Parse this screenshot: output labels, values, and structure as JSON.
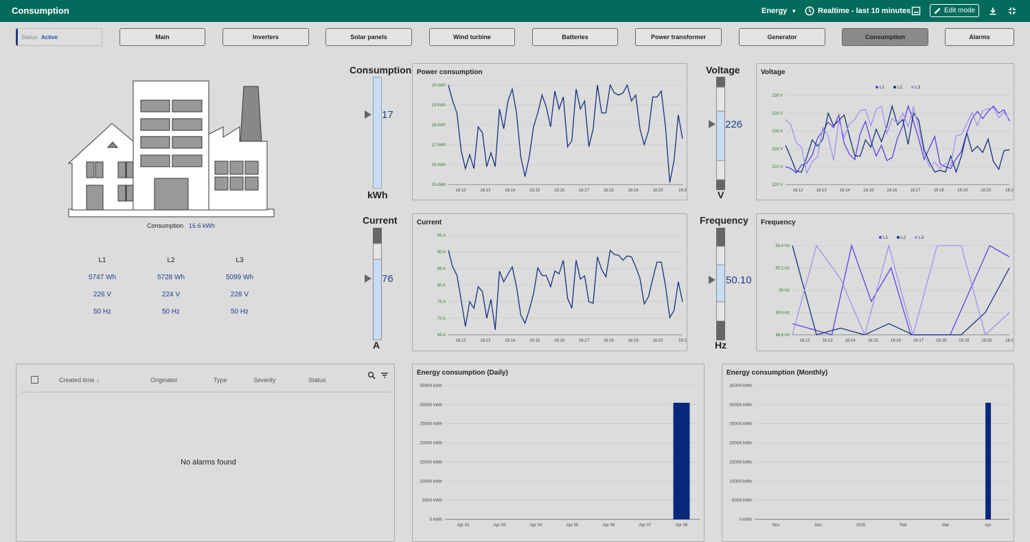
{
  "topbar": {
    "title": "Consumption",
    "dashboard_select": "Energy",
    "timewindow": "Realtime - last 10 minutes",
    "edit_mode": "Edit mode"
  },
  "status": {
    "label": "Status:",
    "value": "Active"
  },
  "nav": [
    "Main",
    "Inverters",
    "Solar panels",
    "Wind turbine",
    "Batteries",
    "Power transformer",
    "Generator",
    "Consumption",
    "Alarms"
  ],
  "nav_active": "Consumption",
  "factory": {
    "label": "Consumption",
    "value": "16.6 kWh",
    "phases": [
      {
        "name": "L1",
        "energy": "5747 Wh",
        "voltage": "226 V",
        "freq": "50 Hz"
      },
      {
        "name": "L2",
        "energy": "5728 Wh",
        "voltage": "224 V",
        "freq": "50 Hz"
      },
      {
        "name": "L3",
        "energy": "5099 Wh",
        "voltage": "228 V",
        "freq": "50 Hz"
      }
    ]
  },
  "gauges": {
    "consumption": {
      "title": "Consumption",
      "value": "17",
      "unit": "kWh"
    },
    "voltage": {
      "title": "Voltage",
      "value": "226",
      "unit": "V"
    },
    "current": {
      "title": "Current",
      "value": "76",
      "unit": "A"
    },
    "frequency": {
      "title": "Frequency",
      "value": "50.10",
      "unit": "Hz"
    }
  },
  "colors": {
    "accent": "#036b5b",
    "series_dark": "#14307a",
    "series_mid": "#5b3fe0",
    "series_light": "#9d92f0",
    "bar": "#08287a"
  },
  "chart_data": [
    {
      "type": "line",
      "id": "power",
      "title": "Power consumption",
      "ylim": [
        15,
        20
      ],
      "yticks": [
        "15 kWh",
        "16 kWh",
        "17 kWh",
        "18 kWh",
        "19 kWh",
        "20 kWh"
      ],
      "xticks": [
        "16:12",
        "16:13",
        "16:14",
        "16:15",
        "16:16",
        "16:17",
        "16:18",
        "16:19",
        "16:20",
        "16:2"
      ],
      "series": [
        {
          "values": [
            20,
            19.2,
            18.6,
            16.7,
            15.8,
            16.5,
            15.8,
            17.9,
            17.6,
            15.9,
            16.6,
            15.9,
            18.8,
            17.8,
            19.2,
            19.8,
            18.6,
            16.4,
            15.4,
            16.4,
            17.9,
            18.6,
            19.5,
            18.9,
            17.9,
            19.7,
            18.8,
            19.4,
            16.9,
            17.2,
            19.8,
            18.8,
            19.2,
            16.9,
            17.8,
            20,
            18.6,
            18.6,
            20,
            19.6,
            19.5,
            19.6,
            20,
            19.2,
            19.5,
            17.8,
            17,
            17.7,
            19.4,
            19.4,
            19.7,
            17.9,
            15.1,
            16.2,
            18.5,
            17.3
          ]
        }
      ]
    },
    {
      "type": "line",
      "id": "voltage",
      "title": "Voltage",
      "ylim": [
        220,
        230
      ],
      "yticks": [
        "220 V",
        "222 V",
        "224 V",
        "226 V",
        "228 V",
        "230 V"
      ],
      "xticks": [
        "16:12",
        "16:13",
        "16:14",
        "16:15",
        "16:16",
        "16:17",
        "16:18",
        "16:19",
        "16:20",
        "16:2"
      ],
      "legend": [
        "L1",
        "L2",
        "L3"
      ],
      "series": [
        {
          "name": "L1",
          "values": [
            222,
            221.8,
            221.3,
            222.2,
            222.4,
            223.3,
            225.2,
            226,
            227,
            226.4,
            227.8,
            224.6,
            223.4,
            222.8,
            225.7,
            227.1,
            224.9,
            223.2,
            224.4,
            222.7,
            223,
            225.2,
            226.6,
            228.8,
            227.1,
            225.1,
            222.8,
            224.1,
            225.4,
            222.3,
            222,
            221.8,
            222.9,
            223.7,
            225.8,
            227.4,
            228.2,
            227.4,
            228.2,
            228.8,
            228,
            228.4,
            227.1
          ]
        },
        {
          "name": "L2",
          "values": [
            224.4,
            223,
            221.5,
            221.4,
            223.1,
            225,
            224.3,
            225.1,
            228,
            226.6,
            227.2,
            227.8,
            225.4,
            223.2,
            223.2,
            225,
            224.2,
            226.2,
            224.8,
            226.5,
            228.8,
            226.7,
            227.3,
            224.5,
            228,
            227.2,
            223.9,
            222.5,
            221.4,
            221.6,
            221.4,
            223.2,
            221.4,
            223.2,
            225.8,
            223.7,
            224.3,
            223.6,
            225.1,
            222.6,
            221.7,
            223.8,
            223.9
          ]
        },
        {
          "name": "L3",
          "values": [
            227.3,
            226.7,
            224.7,
            224.2,
            221.3,
            222.6,
            223.1,
            226.4,
            225.4,
            222.7,
            227.2,
            225.3,
            226.8,
            227.3,
            228.3,
            228.4,
            226.6,
            228.4,
            228.8,
            225.7,
            227.4,
            226.9,
            228,
            226.5,
            228.7,
            226.3,
            223.4,
            222,
            222.5,
            221.8,
            222.4,
            222.1,
            225.5,
            225.6,
            226.8,
            228.1,
            226.6,
            228.3,
            228.5,
            228.6,
            227.5,
            228.1,
            227.3
          ]
        }
      ]
    },
    {
      "type": "line",
      "id": "current",
      "title": "Current",
      "ylim": [
        65,
        95
      ],
      "yticks": [
        "65 A",
        "70 A",
        "75 A",
        "80 A",
        "85 A",
        "90 A",
        "95 A"
      ],
      "xticks": [
        "16:12",
        "16:13",
        "16:14",
        "16:15",
        "16:16",
        "16:17",
        "16:18",
        "16:19",
        "16:20",
        "16:2"
      ],
      "series": [
        {
          "values": [
            90.5,
            85.5,
            83,
            75.5,
            67.5,
            75,
            73,
            79.5,
            78,
            70,
            75.7,
            66.5,
            84.2,
            81,
            83.3,
            85.5,
            79.5,
            71,
            68.5,
            72.5,
            77.4,
            85.2,
            82.9,
            82.9,
            79.5,
            84.2,
            83.4,
            87.5,
            76,
            73,
            87.5,
            81.8,
            82.8,
            75,
            74.5,
            88.5,
            84.7,
            82.5,
            90.5,
            89.2,
            89,
            87.5,
            88.8,
            88.5,
            85.5,
            82,
            74.3,
            76.5,
            81.9,
            86.9,
            86.9,
            79.8,
            70.2,
            72.3,
            81,
            75
          ]
        }
      ]
    },
    {
      "type": "line",
      "id": "frequency",
      "title": "Frequency",
      "ylim": [
        49.6,
        50.4
      ],
      "yticks": [
        "49.6 Hz",
        "49.8 Hz",
        "50 Hz",
        "50.2 Hz",
        "50.4 Hz"
      ],
      "xticks": [
        "16:12",
        "16:13",
        "16:14",
        "16:15",
        "16:16",
        "16:17",
        "16:18",
        "16:19",
        "16:20",
        "16:2"
      ],
      "legend": [
        "L1",
        "L2",
        "L3"
      ],
      "series": [
        {
          "name": "L1",
          "values": [
            49.7,
            49.65,
            49.6,
            50.4,
            49.9,
            50.2,
            49.6,
            49.6,
            49.6,
            50.0,
            50.4,
            50.3
          ]
        },
        {
          "name": "L2",
          "values": [
            50.4,
            49.6,
            49.66,
            49.6,
            49.7,
            49.6,
            49.6,
            49.6,
            49.8,
            50.2
          ]
        },
        {
          "name": "L3",
          "values": [
            49.6,
            50.4,
            50.1,
            49.6,
            50.4,
            49.6,
            50.4,
            50.4,
            49.6,
            49.8
          ]
        }
      ]
    },
    {
      "type": "bar",
      "id": "daily",
      "title": "Energy consumption (Daily)",
      "ylim": [
        0,
        35000
      ],
      "yticks": [
        "0 kWh",
        "5000 kWh",
        "10000 kWh",
        "15000 kWh",
        "20000 kWh",
        "25000 kWh",
        "30000 kWh",
        "35000 kWh"
      ],
      "categories": [
        "Apr 02",
        "Apr 03",
        "Apr 04",
        "Apr 05",
        "Apr 06",
        "Apr 07",
        "Apr 08"
      ],
      "values": [
        0,
        0,
        0,
        0,
        0,
        0,
        30500
      ]
    },
    {
      "type": "bar",
      "id": "monthly",
      "title": "Energy consumption (Monthly)",
      "ylim": [
        0,
        35000
      ],
      "yticks": [
        "0 kWh",
        "5000 kWh",
        "10000 kWh",
        "15000 kWh",
        "20000 kWh",
        "25000 kWh",
        "30000 kWh",
        "35000 kWh"
      ],
      "categories": [
        "Nov",
        "Dec",
        "2025",
        "Feb",
        "Mar",
        "Apr"
      ],
      "values": [
        0,
        0,
        0,
        0,
        0,
        30500
      ]
    }
  ],
  "alarms": {
    "columns": [
      "Created time ↓",
      "Originator",
      "Type",
      "Severity",
      "Status"
    ],
    "empty": "No alarms found"
  }
}
